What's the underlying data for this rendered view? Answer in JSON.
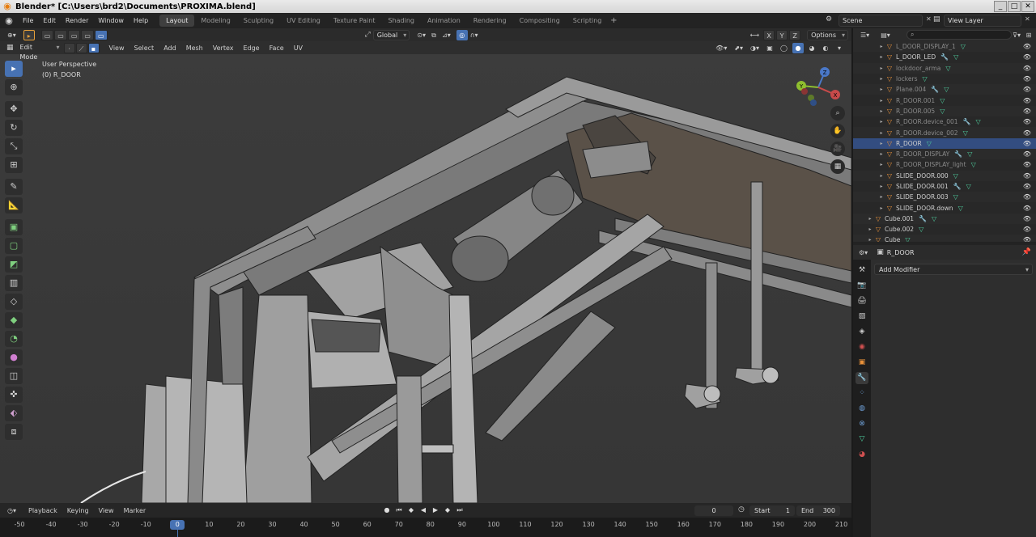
{
  "window": {
    "title": "Blender* [C:\\Users\\brd2\\Documents\\PROXIMA.blend]"
  },
  "menu": [
    "File",
    "Edit",
    "Render",
    "Window",
    "Help"
  ],
  "workspaces": [
    "Layout",
    "Modeling",
    "Sculpting",
    "UV Editing",
    "Texture Paint",
    "Shading",
    "Animation",
    "Rendering",
    "Compositing",
    "Scripting"
  ],
  "active_workspace": "Layout",
  "scene": {
    "name": "Scene",
    "view_layer": "View Layer"
  },
  "viewport": {
    "orientation": "Global",
    "options_label": "Options",
    "axes": [
      "X",
      "Y",
      "Z"
    ],
    "mode": "Edit Mode",
    "menus": [
      "View",
      "Select",
      "Add",
      "Mesh",
      "Vertex",
      "Edge",
      "Face",
      "UV"
    ],
    "view_name": "User Perspective",
    "object_info": "(0) R_DOOR",
    "gizmo": {
      "x": "X",
      "y": "Y",
      "z": "Z"
    }
  },
  "outliner": {
    "rows": [
      {
        "name": "L_DOOR_DISPLAY_1",
        "dim": true
      },
      {
        "name": "L_DOOR_LED",
        "dim": false
      },
      {
        "name": "lockdoor_arma",
        "dim": true
      },
      {
        "name": "lockers",
        "dim": true
      },
      {
        "name": "Plane.004",
        "dim": true
      },
      {
        "name": "R_DOOR.001",
        "dim": true
      },
      {
        "name": "R_DOOR.005",
        "dim": true
      },
      {
        "name": "R_DOOR.device_001",
        "dim": true
      },
      {
        "name": "R_DOOR.device_002",
        "dim": true
      },
      {
        "name": "R_DOOR",
        "dim": false,
        "selected": true
      },
      {
        "name": "R_DOOR_DISPLAY",
        "dim": true
      },
      {
        "name": "R_DOOR_DISPLAY_light",
        "dim": true
      },
      {
        "name": "SLIDE_DOOR.000",
        "dim": false
      },
      {
        "name": "SLIDE_DOOR.001",
        "dim": false
      },
      {
        "name": "SLIDE_DOOR.003",
        "dim": false
      },
      {
        "name": "SLIDE_DOOR.down",
        "dim": false
      },
      {
        "name": "Cube.001",
        "dim": false,
        "top": true
      },
      {
        "name": "Cube.002",
        "dim": false,
        "top": true
      },
      {
        "name": "Cube",
        "dim": false,
        "top": true
      }
    ]
  },
  "properties": {
    "object": "R_DOOR",
    "add_modifier": "Add Modifier"
  },
  "timeline": {
    "menus": [
      "Playback",
      "Keying",
      "View",
      "Marker"
    ],
    "current_frame": "0",
    "start_label": "Start",
    "start": "1",
    "end_label": "End",
    "end": "300",
    "ticks": [
      "-50",
      "-40",
      "-30",
      "-20",
      "-10",
      "0",
      "10",
      "20",
      "30",
      "40",
      "50",
      "60",
      "70",
      "80",
      "90",
      "100",
      "110",
      "120",
      "130",
      "140",
      "150",
      "160",
      "170",
      "180",
      "190",
      "200",
      "210"
    ]
  },
  "colors": {
    "accent": "#4772b3",
    "object_orange": "#e8913a",
    "mesh_green": "#4fd1a0"
  }
}
